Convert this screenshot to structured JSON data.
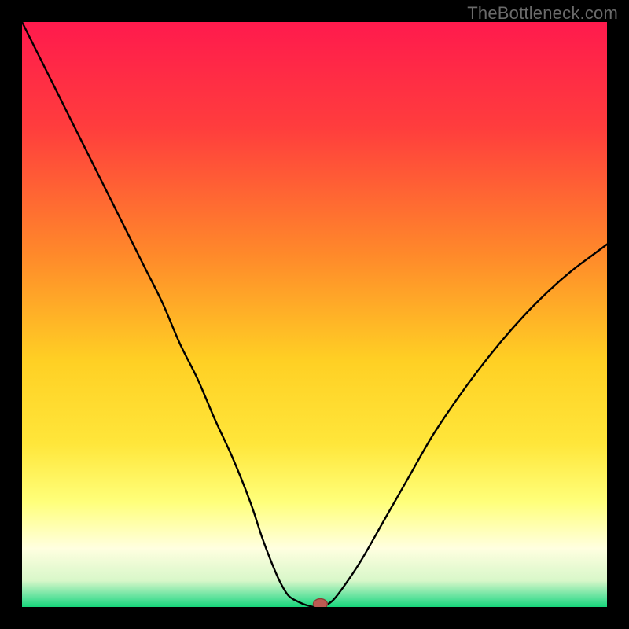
{
  "watermark": "TheBottleneck.com",
  "colors": {
    "frame": "#000000",
    "watermark": "#6b6b6b",
    "gradient_stops": [
      {
        "offset": 0.0,
        "color": "#ff1a4d"
      },
      {
        "offset": 0.18,
        "color": "#ff3d3d"
      },
      {
        "offset": 0.4,
        "color": "#ff8a2a"
      },
      {
        "offset": 0.58,
        "color": "#ffd024"
      },
      {
        "offset": 0.72,
        "color": "#ffe63a"
      },
      {
        "offset": 0.82,
        "color": "#ffff7a"
      },
      {
        "offset": 0.9,
        "color": "#ffffe0"
      },
      {
        "offset": 0.955,
        "color": "#d8f7c9"
      },
      {
        "offset": 0.985,
        "color": "#58e19a"
      },
      {
        "offset": 1.0,
        "color": "#17d67a"
      }
    ],
    "curve": "#000000",
    "marker_fill": "#bc5a52",
    "marker_stroke": "#8e3d36"
  },
  "chart_data": {
    "type": "line",
    "title": "",
    "xlabel": "",
    "ylabel": "",
    "xlim": [
      0,
      100
    ],
    "ylim": [
      0,
      100
    ],
    "grid": false,
    "legend": false,
    "note": "Single V-shaped curve. Values approximate from pixels; y is percent of plot height from bottom.",
    "annotations": [],
    "series": [
      {
        "name": "curve",
        "x": [
          0,
          3,
          6,
          9,
          12,
          15,
          18,
          21,
          24,
          27,
          30,
          33,
          36,
          39,
          41,
          42.5,
          44,
          45.5,
          47,
          49,
          51,
          53,
          55,
          58,
          62,
          66,
          70,
          74,
          78,
          82,
          86,
          90,
          94,
          98,
          100
        ],
        "y": [
          100,
          94,
          88,
          82,
          76,
          70,
          64,
          58,
          52,
          45,
          39,
          32,
          25.5,
          18,
          12,
          8,
          4.5,
          2,
          1,
          0.2,
          0,
          1,
          3.5,
          8,
          15,
          22,
          29,
          35,
          40.5,
          45.5,
          50,
          54,
          57.5,
          60.5,
          62
        ]
      }
    ],
    "marker": {
      "x": 51,
      "y": 0,
      "rx": 1.2,
      "ry": 0.9
    }
  }
}
